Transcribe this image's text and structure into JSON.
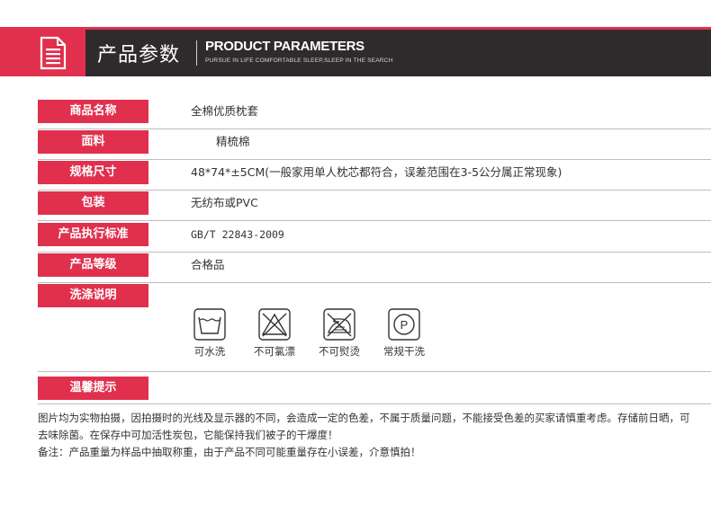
{
  "header": {
    "title_cn": "产品参数",
    "title_en": "PRODUCT PARAMETERS",
    "subtitle": "PURSUE IN LIFE COMFORTABLE SLEEP,SLEEP IN THE SEARCH",
    "accent_color": "#e0304e",
    "bar_color": "#2f2b2d",
    "icon": "document-icon"
  },
  "rows": [
    {
      "label": "商品名称",
      "value": "全棉优质枕套"
    },
    {
      "label": "面料",
      "value": "精梳棉"
    },
    {
      "label": "规格尺寸",
      "value": "48*74*±5CM(一般家用单人枕芯都符合，误差范围在3-5公分属正常现象)"
    },
    {
      "label": "包装",
      "value": "无纺布或PVC"
    },
    {
      "label": "产品执行标准",
      "value": "GB/T 22843-2009"
    },
    {
      "label": "产品等级",
      "value": "合格品"
    },
    {
      "label": "洗涤说明",
      "value": ""
    }
  ],
  "care": [
    {
      "label": "可水洗",
      "icon": "hand-wash-icon"
    },
    {
      "label": "不可氯漂",
      "icon": "no-bleach-icon"
    },
    {
      "label": "不可熨烫",
      "icon": "no-iron-icon"
    },
    {
      "label": "常规干洗",
      "icon": "dry-clean-icon"
    }
  ],
  "warm_tips": {
    "label": "温馨提示",
    "note1": "图片均为实物拍摄，因拍摄时的光线及显示器的不同，会造成一定的色差，不属于质量问题，不能接受色差的买家请慎重考虑。存储前日晒，可去味除菌。在保存中可加活性炭包，它能保持我们被子的干爆度！",
    "note2": "备注：产品重量为样品中抽取称重，由于产品不同可能重量存在小误差，介意慎拍！"
  }
}
